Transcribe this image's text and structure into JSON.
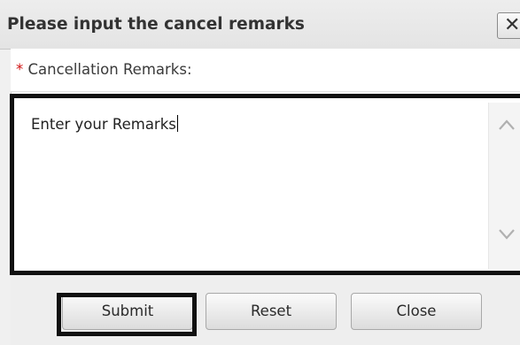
{
  "dialog": {
    "title": "Please input the cancel remarks",
    "close_glyph": "✕"
  },
  "form": {
    "required_marker": "*",
    "remarks_label": "Cancellation Remarks:",
    "remarks_value": "Enter your Remarks"
  },
  "scrollbar": {
    "up_icon": "chevron-up-icon",
    "down_icon": "chevron-down-icon"
  },
  "buttons": {
    "submit": "Submit",
    "reset": "Reset",
    "close": "Close"
  },
  "colors": {
    "required": "#d01010",
    "focus_outline": "#111111"
  }
}
